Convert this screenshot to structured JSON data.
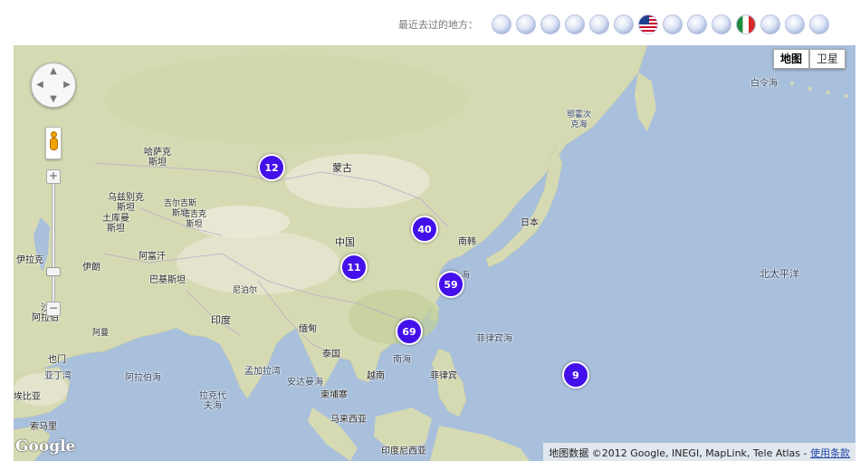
{
  "header": {
    "recent_label": "最近去过的地方：",
    "recent_places": [
      {
        "icon": "seal-icon"
      },
      {
        "icon": "seal-icon"
      },
      {
        "icon": "seal-icon"
      },
      {
        "icon": "seal-icon"
      },
      {
        "icon": "seal-icon"
      },
      {
        "icon": "seal-icon"
      },
      {
        "icon": "us-flag-icon"
      },
      {
        "icon": "seal-icon"
      },
      {
        "icon": "seal-icon"
      },
      {
        "icon": "seal-icon"
      },
      {
        "icon": "italy-flag-icon"
      },
      {
        "icon": "seal-icon"
      },
      {
        "icon": "seal-icon"
      },
      {
        "icon": "seal-icon"
      }
    ]
  },
  "map": {
    "type_buttons": {
      "map": "地图",
      "satellite": "卫星",
      "active": "map"
    },
    "colors": {
      "water": "#a9c0dc",
      "land": "#d8dcb4",
      "marker": "#4410ea"
    },
    "zoom_controls": {
      "plus": "+",
      "minus": "−"
    },
    "logo": "Google",
    "attribution": {
      "text": "地图数据 ©2012 Google, INEGI, MapLink, Tele Atlas - ",
      "terms": "使用条款"
    },
    "labels": {
      "kazakhstan": "哈萨克\n斯坦",
      "mongolia": "蒙古",
      "uzbekistan": "乌兹别克\n斯坦",
      "kyrgyzstan": "吉尔吉斯\n斯坦",
      "turkmenistan": "土库曼\n斯坦",
      "tajikistan": "塔吉克\n斯坦",
      "iraq": "伊拉克",
      "iran": "伊朗",
      "afghanistan": "阿富汗",
      "pakistan": "巴基斯坦",
      "nepal": "尼泊尔",
      "china": "中国",
      "india": "印度",
      "myanmar": "缅甸",
      "thailand": "泰国",
      "vietnam": "越南",
      "south_korea": "南韩",
      "japan": "日本",
      "saudi_arabia": "沙\n阿拉伯",
      "oman": "阿曼",
      "yemen": "也门",
      "gulf_of_aden": "亚丁湾",
      "ethiopia": "埃比亚",
      "somalia": "索马里",
      "arabian_sea": "阿拉伯海",
      "bay_of_bengal": "孟加拉湾",
      "andaman_sea": "安达曼海",
      "laccadive_sea": "拉克代\n夫海",
      "south_china_sea": "南海",
      "philippine_sea": "菲律宾海",
      "philippines": "菲律宾",
      "malaysia": "马来西亚",
      "indonesia": "印度尼西亚",
      "cambodia": "柬埔寨",
      "east_china_sea": "海",
      "okhotsk_sea": "鄂霍次\n克海",
      "bering_sea": "白令海",
      "north_pacific": "北太平洋"
    },
    "markers": [
      {
        "name": "cluster-12",
        "count": "12"
      },
      {
        "name": "cluster-40",
        "count": "40"
      },
      {
        "name": "cluster-11",
        "count": "11"
      },
      {
        "name": "cluster-59",
        "count": "59"
      },
      {
        "name": "cluster-69",
        "count": "69"
      },
      {
        "name": "cluster-9",
        "count": "9"
      }
    ]
  }
}
